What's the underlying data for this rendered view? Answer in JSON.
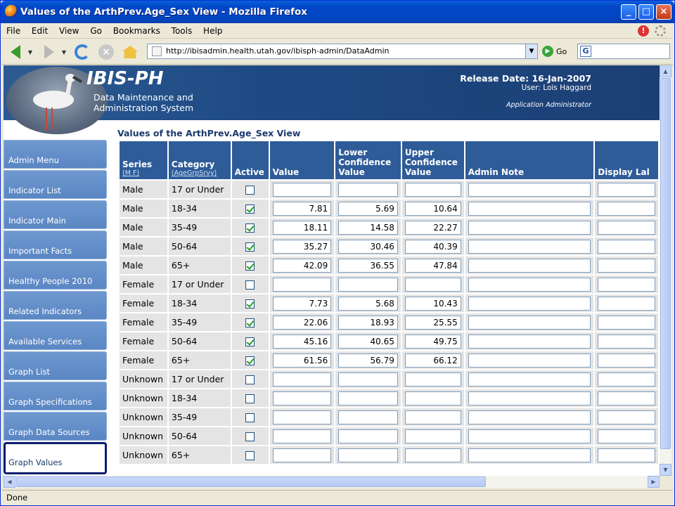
{
  "window": {
    "title": "Values of the ArthPrev.Age_Sex View - Mozilla Firefox",
    "buttons": {
      "minimize": "_",
      "maximize": "□",
      "close": "×"
    }
  },
  "menu": [
    "File",
    "Edit",
    "View",
    "Go",
    "Bookmarks",
    "Tools",
    "Help"
  ],
  "navbar": {
    "url": "http://ibisadmin.health.utah.gov/ibisph-admin/DataAdmin",
    "go_label": "Go",
    "search_value": ""
  },
  "banner": {
    "app_name": "IBIS-PH",
    "subtitle_line1": "Data Maintenance and",
    "subtitle_line2": "Administration System",
    "release": "Release Date: 16-Jan-2007",
    "user": "User: Lois Haggard",
    "role": "Application Administrator"
  },
  "page_title": "Values of the ArthPrev.Age_Sex View",
  "sidebar": {
    "items": [
      {
        "label": "Admin Menu"
      },
      {
        "label": "Indicator List"
      },
      {
        "label": "Indicator Main"
      },
      {
        "label": "Important Facts"
      },
      {
        "label": "Healthy People 2010"
      },
      {
        "label": "Related Indicators"
      },
      {
        "label": "Available Services"
      },
      {
        "label": "Graph List"
      },
      {
        "label": "Graph Specifications"
      },
      {
        "label": "Graph Data Sources"
      },
      {
        "label": "Graph Values",
        "active": true
      }
    ]
  },
  "table": {
    "headers": {
      "series": "Series",
      "series_sub": "(M F)",
      "category": "Category",
      "category_sub": "(AgeGrpSrvy)",
      "active": "Active",
      "value": "Value",
      "lower": "Lower Confidence Value",
      "upper": "Upper Confidence Value",
      "note": "Admin Note",
      "display": "Display Lal"
    },
    "rows": [
      {
        "series": "Male",
        "category": "17 or Under",
        "active": false,
        "value": "",
        "lower": "",
        "upper": ""
      },
      {
        "series": "Male",
        "category": "18-34",
        "active": true,
        "value": "7.81",
        "lower": "5.69",
        "upper": "10.64"
      },
      {
        "series": "Male",
        "category": "35-49",
        "active": true,
        "value": "18.11",
        "lower": "14.58",
        "upper": "22.27"
      },
      {
        "series": "Male",
        "category": "50-64",
        "active": true,
        "value": "35.27",
        "lower": "30.46",
        "upper": "40.39"
      },
      {
        "series": "Male",
        "category": "65+",
        "active": true,
        "value": "42.09",
        "lower": "36.55",
        "upper": "47.84"
      },
      {
        "series": "Female",
        "category": "17 or Under",
        "active": false,
        "value": "",
        "lower": "",
        "upper": ""
      },
      {
        "series": "Female",
        "category": "18-34",
        "active": true,
        "value": "7.73",
        "lower": "5.68",
        "upper": "10.43"
      },
      {
        "series": "Female",
        "category": "35-49",
        "active": true,
        "value": "22.06",
        "lower": "18.93",
        "upper": "25.55"
      },
      {
        "series": "Female",
        "category": "50-64",
        "active": true,
        "value": "45.16",
        "lower": "40.65",
        "upper": "49.75"
      },
      {
        "series": "Female",
        "category": "65+",
        "active": true,
        "value": "61.56",
        "lower": "56.79",
        "upper": "66.12"
      },
      {
        "series": "Unknown",
        "category": "17 or Under",
        "active": false,
        "value": "",
        "lower": "",
        "upper": ""
      },
      {
        "series": "Unknown",
        "category": "18-34",
        "active": false,
        "value": "",
        "lower": "",
        "upper": ""
      },
      {
        "series": "Unknown",
        "category": "35-49",
        "active": false,
        "value": "",
        "lower": "",
        "upper": ""
      },
      {
        "series": "Unknown",
        "category": "50-64",
        "active": false,
        "value": "",
        "lower": "",
        "upper": ""
      },
      {
        "series": "Unknown",
        "category": "65+",
        "active": false,
        "value": "",
        "lower": "",
        "upper": ""
      }
    ]
  },
  "status": "Done",
  "colors": {
    "banner": "#1e4a84",
    "header": "#2e5c98",
    "sidebar": "#5a86c3",
    "check": "#21a121"
  }
}
